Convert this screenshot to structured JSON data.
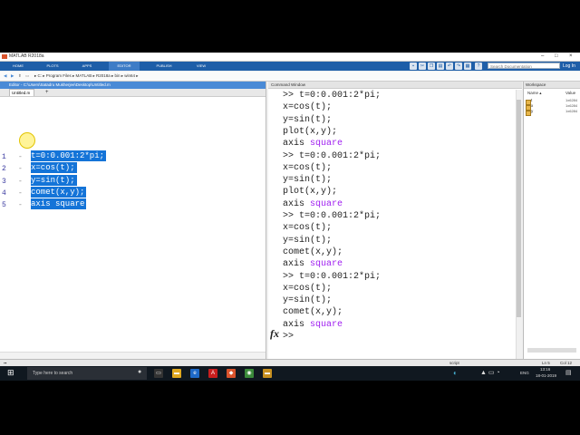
{
  "window": {
    "title": "MATLAB R2018a",
    "controls": [
      "–",
      "□",
      "×"
    ]
  },
  "ribbon": {
    "tabs": [
      "HOME",
      "PLOTS",
      "APPS",
      "EDITOR",
      "PUBLISH",
      "VIEW"
    ],
    "selected_tab": "EDITOR",
    "search_placeholder": "Search Documentation",
    "login": "Log In"
  },
  "pathbar": {
    "path": "▸ C: ▸ Program Files ▸ MATLAB ▸ R2018a ▸ bin ▸ win64 ▸"
  },
  "editor": {
    "title": "Editor - C:\\Users\\Satadru Mukherjee\\Desktop\\Untitled.m",
    "tab_label": "Untitled.m",
    "lines": [
      {
        "num": "1",
        "code": "t=0:0.001:2*pi;"
      },
      {
        "num": "2",
        "code": "x=cos(t);"
      },
      {
        "num": "3",
        "code": "y=sin(t);"
      },
      {
        "num": "4",
        "code": "comet(x,y);"
      },
      {
        "num": "5",
        "code": "axis square"
      }
    ]
  },
  "command_window": {
    "title": "Command Window",
    "lines": [
      {
        "code": ">> t=0:0.001:2*pi;",
        "kw": ""
      },
      {
        "code": "x=cos(t);",
        "kw": ""
      },
      {
        "code": "y=sin(t);",
        "kw": ""
      },
      {
        "code": "plot(x,y);",
        "kw": ""
      },
      {
        "code": "axis ",
        "kw": "square"
      },
      {
        "code": ">> t=0:0.001:2*pi;",
        "kw": ""
      },
      {
        "code": "x=cos(t);",
        "kw": ""
      },
      {
        "code": "y=sin(t);",
        "kw": ""
      },
      {
        "code": "plot(x,y);",
        "kw": ""
      },
      {
        "code": "axis ",
        "kw": "square"
      },
      {
        "code": ">> t=0:0.001:2*pi;",
        "kw": ""
      },
      {
        "code": "x=cos(t);",
        "kw": ""
      },
      {
        "code": "y=sin(t);",
        "kw": ""
      },
      {
        "code": "comet(x,y);",
        "kw": ""
      },
      {
        "code": "axis ",
        "kw": "square"
      },
      {
        "code": ">> t=0:0.001:2*pi;",
        "kw": ""
      },
      {
        "code": "x=cos(t);",
        "kw": ""
      },
      {
        "code": "y=sin(t);",
        "kw": ""
      },
      {
        "code": "comet(x,y);",
        "kw": ""
      },
      {
        "code": "axis ",
        "kw": "square"
      }
    ],
    "prompt": ">>",
    "fx": "fx"
  },
  "workspace": {
    "title": "Workspace",
    "col_name": "Name ▴",
    "col_value": "Value",
    "vars": [
      {
        "name": "t",
        "value": "1x6284"
      },
      {
        "name": "x",
        "value": "1x6284"
      },
      {
        "name": "y",
        "value": "1x6284"
      }
    ]
  },
  "statusbar": {
    "mode": "script",
    "ln": "Ln 5",
    "col": "Col 12"
  },
  "taskbar": {
    "search_text": "Type here to search",
    "lang": "ENG",
    "time": "13:16",
    "date": "18-01-2019"
  },
  "colors": {
    "ribbon": "#1e5ea8",
    "selection": "#1474d8",
    "keyword": "#a020f0"
  }
}
